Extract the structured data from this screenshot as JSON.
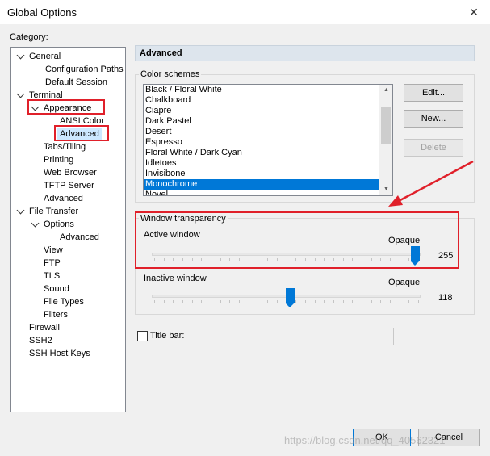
{
  "window": {
    "title": "Global Options"
  },
  "category_label": "Category:",
  "tree": [
    {
      "label": "General",
      "level": 0,
      "chevron": "down"
    },
    {
      "label": "Configuration Paths",
      "level": 2
    },
    {
      "label": "Default Session",
      "level": 2
    },
    {
      "label": "Terminal",
      "level": 0,
      "chevron": "down"
    },
    {
      "label": "Appearance",
      "level": 1,
      "chevron": "down"
    },
    {
      "label": "ANSI Color",
      "level": 2
    },
    {
      "label": "Advanced",
      "level": 2,
      "selected": true
    },
    {
      "label": "Tabs/Tiling",
      "level": 1
    },
    {
      "label": "Printing",
      "level": 1
    },
    {
      "label": "Web Browser",
      "level": 1
    },
    {
      "label": "TFTP Server",
      "level": 1
    },
    {
      "label": "Advanced",
      "level": 1
    },
    {
      "label": "File Transfer",
      "level": 0,
      "chevron": "down"
    },
    {
      "label": "Options",
      "level": 1,
      "chevron": "down"
    },
    {
      "label": "Advanced",
      "level": 2
    },
    {
      "label": "View",
      "level": 1
    },
    {
      "label": "FTP",
      "level": 1
    },
    {
      "label": "TLS",
      "level": 1
    },
    {
      "label": "Sound",
      "level": 1
    },
    {
      "label": "File Types",
      "level": 1
    },
    {
      "label": "Filters",
      "level": 1
    },
    {
      "label": "Firewall",
      "level": 0
    },
    {
      "label": "SSH2",
      "level": 0
    },
    {
      "label": "SSH Host Keys",
      "level": 0
    }
  ],
  "panel": {
    "header": "Advanced"
  },
  "color_schemes": {
    "label": "Color schemes",
    "items": [
      "Black / Floral White",
      "Chalkboard",
      "Ciapre",
      "Dark Pastel",
      "Desert",
      "Espresso",
      "Floral White / Dark Cyan",
      "Idletoes",
      "Invisibone",
      "Monochrome",
      "Novel"
    ],
    "selected_index": 9,
    "buttons": {
      "edit": "Edit...",
      "new": "New...",
      "delete": "Delete"
    }
  },
  "transparency": {
    "label": "Window transparency",
    "active": {
      "label": "Active window",
      "end_label": "Opaque",
      "value": "255",
      "level": 255
    },
    "inactive": {
      "label": "Inactive window",
      "end_label": "Opaque",
      "value": "118",
      "level": 118
    }
  },
  "title_bar": {
    "label": "Title bar:",
    "value": ""
  },
  "footer": {
    "ok": "OK",
    "cancel": "Cancel"
  },
  "watermark": "https://blog.csdn.net/qq_40562321",
  "colors": {
    "accent": "#0078d7",
    "highlight": "#e0202a",
    "selection": "#cce8ff"
  }
}
